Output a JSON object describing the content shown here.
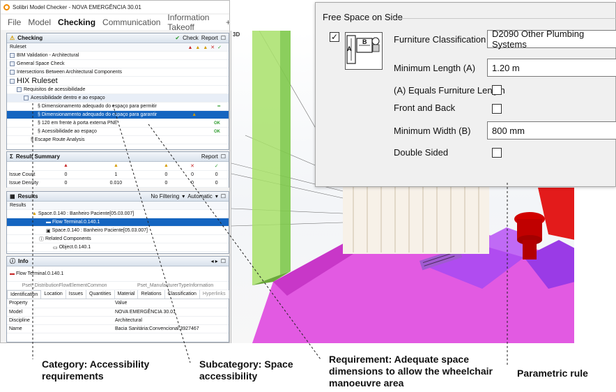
{
  "window": {
    "title": "Solibri Model Checker - NOVA EMERGÊNCIA 30.01"
  },
  "menu": {
    "items": [
      "File",
      "Model",
      "Checking",
      "Communication",
      "Information Takeoff",
      "+"
    ],
    "active": "Checking"
  },
  "checking": {
    "title": "Checking",
    "toolbar": {
      "check": "Check",
      "report": "Report"
    },
    "column_header": "Ruleset",
    "rows": [
      {
        "label": "BIM Validation - Architectural"
      },
      {
        "label": "General Space Check"
      },
      {
        "label": "Intersections Between Architectural Components"
      },
      {
        "label": "HIX Ruleset"
      },
      {
        "label": "Requisitos de acessibilidade"
      },
      {
        "label": "Acessibilidade dentro e ao espaço"
      },
      {
        "label": "Dimensionamento adequado do espaço para permitir"
      },
      {
        "label": "Dimensionamento adequado do espaço para garantir"
      },
      {
        "label": "120 em frente à porta externa PNE",
        "status": "OK"
      },
      {
        "label": "Acessibilidade ao espaço",
        "status": "OK"
      },
      {
        "label": "Escape Route Analysis"
      }
    ]
  },
  "result_summary": {
    "title": "Result Summary",
    "report": "Report",
    "rows": [
      {
        "label": "Issue Count",
        "values": [
          "0",
          "1",
          "0",
          "0",
          "0"
        ]
      },
      {
        "label": "Issue Density",
        "values": [
          "0",
          "0.010",
          "0",
          "0",
          "0"
        ]
      }
    ]
  },
  "results": {
    "title": "Results",
    "filter": "No Filtering",
    "mode": "Automatic",
    "column_header": "Results",
    "rows": [
      {
        "label": "Space.0.140 : Banheiro Paciente[05.03.007]"
      },
      {
        "label": "Flow Terminal.0.140.1"
      },
      {
        "label": "Space.0.140 : Banheiro Paciente[05.03.007]"
      },
      {
        "label": "Related Components"
      },
      {
        "label": "Object.0.140.1"
      }
    ]
  },
  "info": {
    "title": "Info",
    "entity": "Flow Terminal.0.140.1",
    "pset_tabs": [
      "Pset_DistributionFlowElementCommon",
      "Pset_ManufacturerTypeInformation"
    ],
    "tabs": [
      "Identification",
      "Location",
      "Issues",
      "Quantities",
      "Material",
      "Relations",
      "Classification",
      "Hyperlinks"
    ],
    "headers": [
      "Property",
      "Value"
    ],
    "rows": [
      {
        "property": "Model",
        "value": "NOVA EMERGÊNCIA 30.01"
      },
      {
        "property": "Discipline",
        "value": "Architectural"
      },
      {
        "property": "Name",
        "value": "Bacia Sanitária:Convencional:3927467"
      }
    ]
  },
  "viewport": {
    "tab": "3D"
  },
  "dialog": {
    "title": "Free Space on Side",
    "furniture_classification_label": "Furniture Classification",
    "furniture_classification_value": "D2090 Other Plumbing Systems",
    "min_length_label": "Minimum Length (A)",
    "min_length_value": "1.20 m",
    "equals_furniture_length_label": "(A) Equals Furniture Length",
    "front_and_back_label": "Front and Back",
    "min_width_label": "Minimum Width (B)",
    "min_width_value": "800 mm",
    "double_sided_label": "Double Sided",
    "diagram_label_a": "A",
    "diagram_label_b": "B"
  },
  "callouts": {
    "category": "Category: Accessibility requirements",
    "subcategory": "Subcategory: Space accessibility",
    "requirement": "Requirement: Adequate space dimensions to allow the wheelchair manoeuvre area",
    "parametric": "Parametric rule"
  }
}
